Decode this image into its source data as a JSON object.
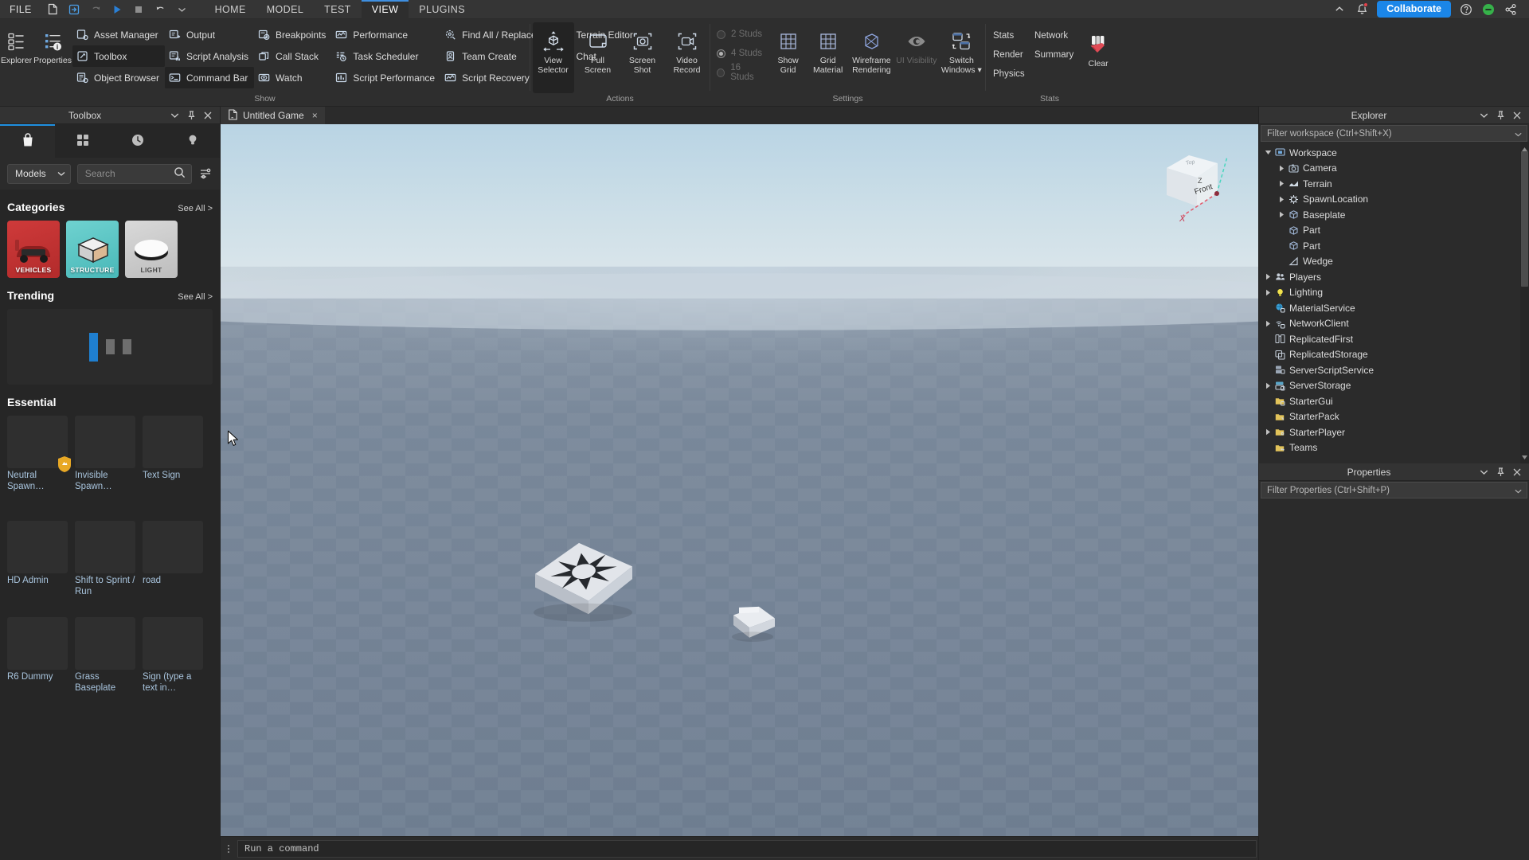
{
  "menubar": {
    "file_label": "FILE",
    "quick_actions": [
      "new-file-icon",
      "import-icon",
      "redo-icon",
      "play-icon",
      "stop-icon",
      "undo-icon",
      "undo-dropdown-icon"
    ],
    "tabs": [
      {
        "label": "HOME",
        "active": false
      },
      {
        "label": "MODEL",
        "active": false
      },
      {
        "label": "TEST",
        "active": false
      },
      {
        "label": "VIEW",
        "active": true
      },
      {
        "label": "PLUGINS",
        "active": false
      }
    ],
    "collaborate_label": "Collaborate",
    "right_icons": [
      "chevron-up-icon",
      "notification-bell-icon",
      "help-icon",
      "status-online-icon",
      "share-icon"
    ]
  },
  "ribbon": {
    "groups": [
      {
        "label": "Show",
        "big_buttons": [
          {
            "label": "Explorer",
            "icon": "explorer-icon",
            "selected": false
          },
          {
            "label": "Properties",
            "icon": "properties-icon",
            "selected": false
          }
        ],
        "columns": [
          [
            "Asset Manager",
            "Toolbox",
            "Object Browser"
          ],
          [
            "Output",
            "Script Analysis",
            "Command Bar"
          ],
          [
            "Breakpoints",
            "Call Stack",
            "Watch"
          ],
          [
            "Performance",
            "Task Scheduler",
            "Script Performance"
          ],
          [
            "Find All / Replace All",
            "Team Create",
            "Script Recovery"
          ],
          [
            "Terrain Editor",
            "Chat"
          ]
        ],
        "selected_items": [
          "Toolbox",
          "Command Bar"
        ]
      },
      {
        "label": "Actions",
        "big_buttons": [
          {
            "label": "View\nSelector",
            "icon": "view-selector-icon",
            "selected": true
          },
          {
            "label": "Full\nScreen",
            "icon": "full-screen-icon",
            "selected": false
          },
          {
            "label": "Screen\nShot",
            "icon": "screen-shot-icon",
            "selected": false
          },
          {
            "label": "Video\nRecord",
            "icon": "video-record-icon",
            "selected": false
          }
        ]
      },
      {
        "label": "Settings",
        "studs": [
          {
            "label": "2 Studs",
            "on": false
          },
          {
            "label": "4 Studs",
            "on": true
          },
          {
            "label": "16 Studs",
            "on": false
          }
        ],
        "big_buttons": [
          {
            "label": "Show\nGrid",
            "icon": "show-grid-icon",
            "selected": false
          },
          {
            "label": "Grid\nMaterial",
            "icon": "grid-material-icon",
            "selected": false
          },
          {
            "label": "Wireframe\nRendering",
            "icon": "wireframe-icon",
            "selected": false
          },
          {
            "label": "UI Visibility",
            "icon": "ui-visibility-icon",
            "selected": false,
            "dim": true
          },
          {
            "label": "Switch\nWindows",
            "icon": "switch-windows-icon",
            "selected": false,
            "dropdown": true
          }
        ]
      },
      {
        "label": "Stats",
        "stat_rows": [
          [
            "Stats",
            "Network"
          ],
          [
            "Render",
            "Summary"
          ],
          [
            "Physics",
            ""
          ]
        ],
        "clear_label": "Clear",
        "clear_icon": "clear-broom-icon"
      }
    ]
  },
  "toolbox": {
    "title": "Toolbox",
    "header_buttons": [
      "chevron-down-icon",
      "pin-icon",
      "close-icon"
    ],
    "tabs": [
      {
        "icon": "marketplace-bag-icon",
        "active": true
      },
      {
        "icon": "inventory-grid-icon",
        "active": false
      },
      {
        "icon": "recent-clock-icon",
        "active": false
      },
      {
        "icon": "creator-bulb-icon",
        "active": false
      }
    ],
    "dropdown_value": "Models",
    "search_placeholder": "Search",
    "filter_icon": "filter-sliders-icon",
    "categories": {
      "title": "Categories",
      "see_all": "See All >",
      "items": [
        {
          "label": "VEHICLES",
          "color": "#c23b3b"
        },
        {
          "label": "STRUCTURE",
          "color": "#5cc6c4"
        },
        {
          "label": "LIGHT",
          "color": "#d4d4d4"
        }
      ]
    },
    "trending": {
      "title": "Trending",
      "see_all": "See All >"
    },
    "essential": {
      "title": "Essential",
      "items": [
        {
          "label": "Neutral Spawn…",
          "verified": true
        },
        {
          "label": "Invisible Spawn…",
          "verified": false
        },
        {
          "label": "Text Sign",
          "verified": false
        },
        {
          "label": "HD Admin",
          "verified": false
        },
        {
          "label": "Shift to Sprint / Run",
          "verified": false
        },
        {
          "label": "road",
          "verified": false
        },
        {
          "label": "R6 Dummy",
          "verified": false
        },
        {
          "label": "Grass Baseplate",
          "verified": false
        },
        {
          "label": "Sign (type a text in…",
          "verified": false
        }
      ]
    }
  },
  "viewport": {
    "tab": {
      "label": "Untitled Game",
      "icon": "game-file-icon",
      "close": "×"
    },
    "view_selector": {
      "front_label": "Front",
      "z_label": "Z",
      "x_label": "X",
      "top_label": "Top"
    },
    "command_bar": {
      "placeholder": "Run a command"
    }
  },
  "explorer": {
    "title": "Explorer",
    "header_buttons": [
      "chevron-down-icon",
      "pin-icon",
      "close-icon"
    ],
    "filter_placeholder": "Filter workspace (Ctrl+Shift+X)",
    "tree": [
      {
        "label": "Workspace",
        "depth": 0,
        "arrow": "down",
        "icon": "workspace-icon"
      },
      {
        "label": "Camera",
        "depth": 1,
        "arrow": "right",
        "icon": "camera-icon"
      },
      {
        "label": "Terrain",
        "depth": 1,
        "arrow": "right",
        "icon": "terrain-icon"
      },
      {
        "label": "SpawnLocation",
        "depth": 1,
        "arrow": "right",
        "icon": "spawnlocation-icon"
      },
      {
        "label": "Baseplate",
        "depth": 1,
        "arrow": "right",
        "icon": "part-icon"
      },
      {
        "label": "Part",
        "depth": 1,
        "arrow": "none",
        "icon": "part-icon"
      },
      {
        "label": "Part",
        "depth": 1,
        "arrow": "none",
        "icon": "part-icon"
      },
      {
        "label": "Wedge",
        "depth": 1,
        "arrow": "none",
        "icon": "wedge-icon"
      },
      {
        "label": "Players",
        "depth": 0,
        "arrow": "right",
        "icon": "players-icon"
      },
      {
        "label": "Lighting",
        "depth": 0,
        "arrow": "right",
        "icon": "lighting-icon"
      },
      {
        "label": "MaterialService",
        "depth": 0,
        "arrow": "none",
        "icon": "materialservice-icon"
      },
      {
        "label": "NetworkClient",
        "depth": 0,
        "arrow": "right",
        "icon": "networkclient-icon"
      },
      {
        "label": "ReplicatedFirst",
        "depth": 0,
        "arrow": "none",
        "icon": "replicatedfirst-icon"
      },
      {
        "label": "ReplicatedStorage",
        "depth": 0,
        "arrow": "none",
        "icon": "replicatedstorage-icon"
      },
      {
        "label": "ServerScriptService",
        "depth": 0,
        "arrow": "none",
        "icon": "serverscriptservice-icon"
      },
      {
        "label": "ServerStorage",
        "depth": 0,
        "arrow": "right",
        "icon": "serverstorage-icon"
      },
      {
        "label": "StarterGui",
        "depth": 0,
        "arrow": "none",
        "icon": "startergui-icon"
      },
      {
        "label": "StarterPack",
        "depth": 0,
        "arrow": "none",
        "icon": "starterpack-icon"
      },
      {
        "label": "StarterPlayer",
        "depth": 0,
        "arrow": "right",
        "icon": "starterplayer-icon"
      },
      {
        "label": "Teams",
        "depth": 0,
        "arrow": "none",
        "icon": "teams-icon"
      }
    ]
  },
  "properties": {
    "title": "Properties",
    "header_buttons": [
      "chevron-down-icon",
      "pin-icon",
      "close-icon"
    ],
    "filter_placeholder": "Filter Properties (Ctrl+Shift+P)"
  },
  "colors": {
    "accent": "#1b86e8",
    "tab_underline": "#3f8fe0",
    "panel_bg": "#2b2b2b",
    "ribbon_bg": "#2e2e2e",
    "link_text": "#a8c4dd",
    "online_green": "#36b24a",
    "alert_red": "#e4414a"
  }
}
